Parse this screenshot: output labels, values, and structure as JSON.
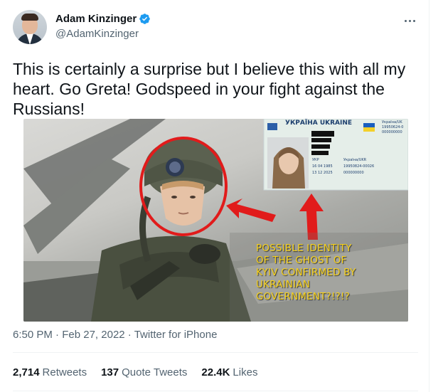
{
  "author": {
    "display_name": "Adam Kinzinger",
    "handle": "@AdamKinzinger",
    "verified_icon": "verified-badge-icon",
    "accent": "#1d9bf0"
  },
  "tweet": {
    "text": "This is certainly a surprise but I believe this with all my heart. Go Greta! Godspeed in your fight against the Russians!"
  },
  "media": {
    "caption_lines": [
      "POSSIBLE IDENTITY",
      "OF THE GHOST OF",
      "KYIV CONFIRMED BY",
      "UKRAINIAN",
      "GOVERNMENT?!?!?"
    ],
    "id_card": {
      "header": "УКРАЇНА UKRAINE",
      "right_top": "Україна/UK",
      "right_number": "19950624-0",
      "right_zeros": "000000000",
      "field_country": "Україна/UKR",
      "field_date1": "16 04 1985",
      "field_doc": "19950824-00026",
      "field_date2": "13 12 2025",
      "field_code": "000000000",
      "field_ykp": "УКР"
    }
  },
  "meta": {
    "time": "6:50 PM",
    "sep1": "·",
    "date": "Feb 27, 2022",
    "sep2": "·",
    "source": "Twitter for iPhone"
  },
  "stats": {
    "retweets_count": "2,714",
    "retweets_label": "Retweets",
    "quotes_count": "137",
    "quotes_label": "Quote Tweets",
    "likes_count": "22.4K",
    "likes_label": "Likes"
  }
}
